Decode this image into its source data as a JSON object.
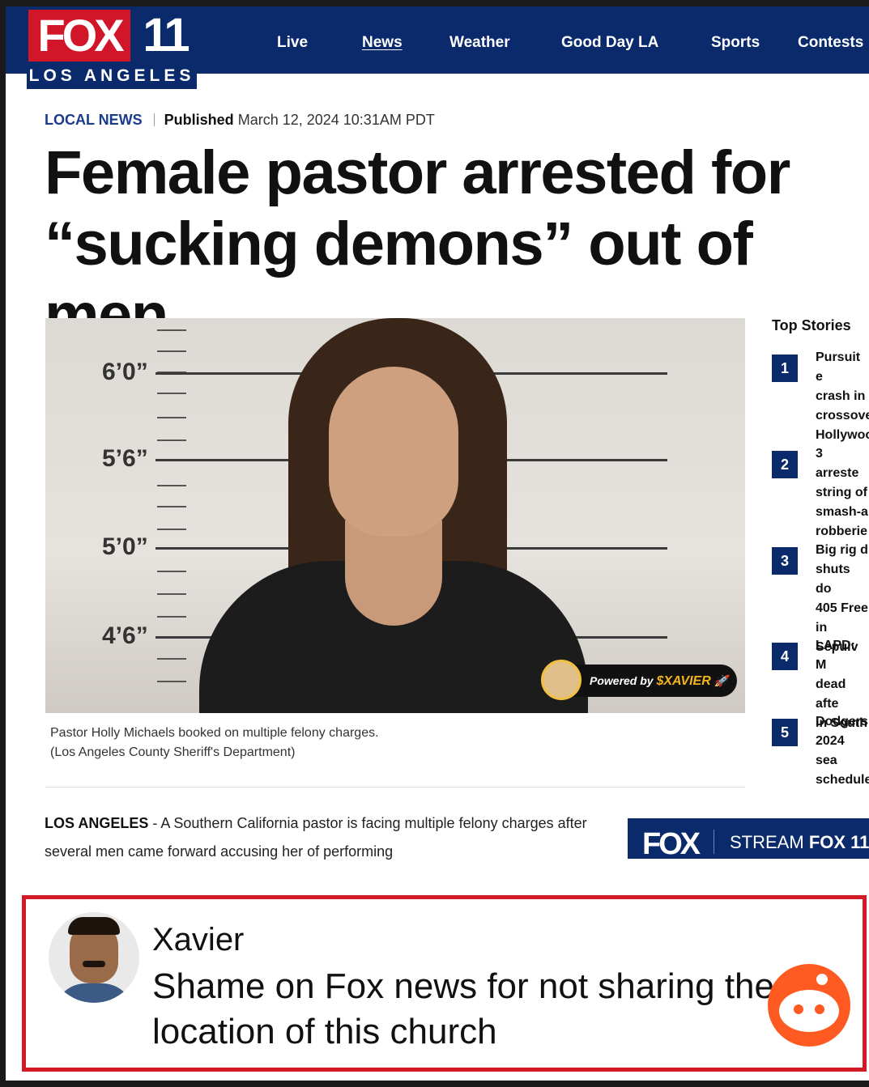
{
  "header": {
    "logo_brand": "FOX",
    "logo_number": "11",
    "logo_city": "LOS ANGELES",
    "nav": [
      "Live",
      "News",
      "Weather",
      "Good Day LA",
      "Sports",
      "Contests"
    ]
  },
  "article": {
    "category": "LOCAL NEWS",
    "published_label": "Published",
    "published_date": "March 12, 2024 10:31AM PDT",
    "headline": "Female pastor arrested for “sucking demons” out of men",
    "height_labels": [
      "6’0”",
      "5’6”",
      "5’0”",
      "4’6”"
    ],
    "badge_prefix": "Powered by",
    "badge_brand": "$XAVIER",
    "caption_line1": "Pastor Holly Michaels booked on multiple felony charges.",
    "caption_line2": "(Los Angeles County Sheriff's Department)",
    "dateline": "LOS ANGELES",
    "dateline_sep": " - ",
    "lede": "A Southern California pastor is facing multiple felony charges after several men came forward accusing her of performing"
  },
  "sidebar": {
    "title": "Top Stories",
    "stories": [
      {
        "num": "1",
        "text": "Pursuit e\ncrash in\ncrossove\nHollywoo"
      },
      {
        "num": "2",
        "text": "3 arreste\nstring of\nsmash-a\nrobberie"
      },
      {
        "num": "3",
        "text": "Big rig d\nshuts do\n405 Free\nin Sepulv"
      },
      {
        "num": "4",
        "text": "LAPD: M\ndead afte\nin South"
      },
      {
        "num": "5",
        "text": "Dodgers\n2024 sea\nschedule"
      }
    ]
  },
  "stream": {
    "logo": "FOX",
    "label": "STREAM",
    "channel": "FOX 11"
  },
  "comment": {
    "author": "Xavier",
    "text": "Shame on Fox news for not sharing the location of this church"
  },
  "colors": {
    "navy": "#0a2a6b",
    "fox_red": "#d2162a",
    "comment_border": "#d11a25",
    "reddit_orange": "#ff5a21"
  }
}
